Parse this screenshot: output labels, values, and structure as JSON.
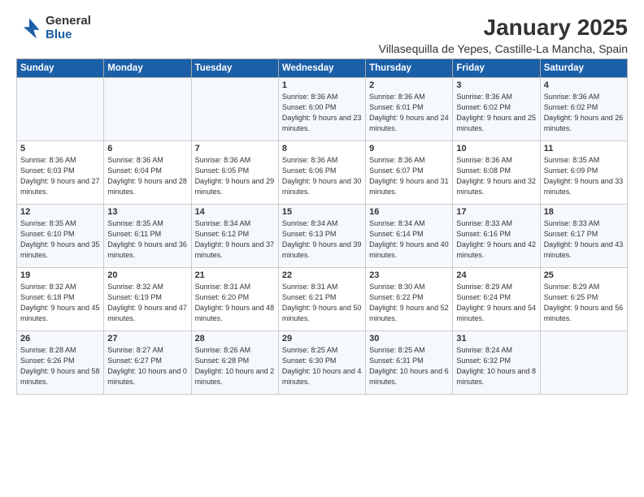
{
  "logo": {
    "general": "General",
    "blue": "Blue"
  },
  "title": "January 2025",
  "subtitle": "Villasequilla de Yepes, Castille-La Mancha, Spain",
  "weekdays": [
    "Sunday",
    "Monday",
    "Tuesday",
    "Wednesday",
    "Thursday",
    "Friday",
    "Saturday"
  ],
  "weeks": [
    [
      {
        "day": "",
        "detail": ""
      },
      {
        "day": "",
        "detail": ""
      },
      {
        "day": "",
        "detail": ""
      },
      {
        "day": "1",
        "detail": "Sunrise: 8:36 AM\nSunset: 6:00 PM\nDaylight: 9 hours\nand 23 minutes."
      },
      {
        "day": "2",
        "detail": "Sunrise: 8:36 AM\nSunset: 6:01 PM\nDaylight: 9 hours\nand 24 minutes."
      },
      {
        "day": "3",
        "detail": "Sunrise: 8:36 AM\nSunset: 6:02 PM\nDaylight: 9 hours\nand 25 minutes."
      },
      {
        "day": "4",
        "detail": "Sunrise: 8:36 AM\nSunset: 6:02 PM\nDaylight: 9 hours\nand 26 minutes."
      }
    ],
    [
      {
        "day": "5",
        "detail": "Sunrise: 8:36 AM\nSunset: 6:03 PM\nDaylight: 9 hours\nand 27 minutes."
      },
      {
        "day": "6",
        "detail": "Sunrise: 8:36 AM\nSunset: 6:04 PM\nDaylight: 9 hours\nand 28 minutes."
      },
      {
        "day": "7",
        "detail": "Sunrise: 8:36 AM\nSunset: 6:05 PM\nDaylight: 9 hours\nand 29 minutes."
      },
      {
        "day": "8",
        "detail": "Sunrise: 8:36 AM\nSunset: 6:06 PM\nDaylight: 9 hours\nand 30 minutes."
      },
      {
        "day": "9",
        "detail": "Sunrise: 8:36 AM\nSunset: 6:07 PM\nDaylight: 9 hours\nand 31 minutes."
      },
      {
        "day": "10",
        "detail": "Sunrise: 8:36 AM\nSunset: 6:08 PM\nDaylight: 9 hours\nand 32 minutes."
      },
      {
        "day": "11",
        "detail": "Sunrise: 8:35 AM\nSunset: 6:09 PM\nDaylight: 9 hours\nand 33 minutes."
      }
    ],
    [
      {
        "day": "12",
        "detail": "Sunrise: 8:35 AM\nSunset: 6:10 PM\nDaylight: 9 hours\nand 35 minutes."
      },
      {
        "day": "13",
        "detail": "Sunrise: 8:35 AM\nSunset: 6:11 PM\nDaylight: 9 hours\nand 36 minutes."
      },
      {
        "day": "14",
        "detail": "Sunrise: 8:34 AM\nSunset: 6:12 PM\nDaylight: 9 hours\nand 37 minutes."
      },
      {
        "day": "15",
        "detail": "Sunrise: 8:34 AM\nSunset: 6:13 PM\nDaylight: 9 hours\nand 39 minutes."
      },
      {
        "day": "16",
        "detail": "Sunrise: 8:34 AM\nSunset: 6:14 PM\nDaylight: 9 hours\nand 40 minutes."
      },
      {
        "day": "17",
        "detail": "Sunrise: 8:33 AM\nSunset: 6:16 PM\nDaylight: 9 hours\nand 42 minutes."
      },
      {
        "day": "18",
        "detail": "Sunrise: 8:33 AM\nSunset: 6:17 PM\nDaylight: 9 hours\nand 43 minutes."
      }
    ],
    [
      {
        "day": "19",
        "detail": "Sunrise: 8:32 AM\nSunset: 6:18 PM\nDaylight: 9 hours\nand 45 minutes."
      },
      {
        "day": "20",
        "detail": "Sunrise: 8:32 AM\nSunset: 6:19 PM\nDaylight: 9 hours\nand 47 minutes."
      },
      {
        "day": "21",
        "detail": "Sunrise: 8:31 AM\nSunset: 6:20 PM\nDaylight: 9 hours\nand 48 minutes."
      },
      {
        "day": "22",
        "detail": "Sunrise: 8:31 AM\nSunset: 6:21 PM\nDaylight: 9 hours\nand 50 minutes."
      },
      {
        "day": "23",
        "detail": "Sunrise: 8:30 AM\nSunset: 6:22 PM\nDaylight: 9 hours\nand 52 minutes."
      },
      {
        "day": "24",
        "detail": "Sunrise: 8:29 AM\nSunset: 6:24 PM\nDaylight: 9 hours\nand 54 minutes."
      },
      {
        "day": "25",
        "detail": "Sunrise: 8:29 AM\nSunset: 6:25 PM\nDaylight: 9 hours\nand 56 minutes."
      }
    ],
    [
      {
        "day": "26",
        "detail": "Sunrise: 8:28 AM\nSunset: 6:26 PM\nDaylight: 9 hours\nand 58 minutes."
      },
      {
        "day": "27",
        "detail": "Sunrise: 8:27 AM\nSunset: 6:27 PM\nDaylight: 10 hours\nand 0 minutes."
      },
      {
        "day": "28",
        "detail": "Sunrise: 8:26 AM\nSunset: 6:28 PM\nDaylight: 10 hours\nand 2 minutes."
      },
      {
        "day": "29",
        "detail": "Sunrise: 8:25 AM\nSunset: 6:30 PM\nDaylight: 10 hours\nand 4 minutes."
      },
      {
        "day": "30",
        "detail": "Sunrise: 8:25 AM\nSunset: 6:31 PM\nDaylight: 10 hours\nand 6 minutes."
      },
      {
        "day": "31",
        "detail": "Sunrise: 8:24 AM\nSunset: 6:32 PM\nDaylight: 10 hours\nand 8 minutes."
      },
      {
        "day": "",
        "detail": ""
      }
    ]
  ]
}
